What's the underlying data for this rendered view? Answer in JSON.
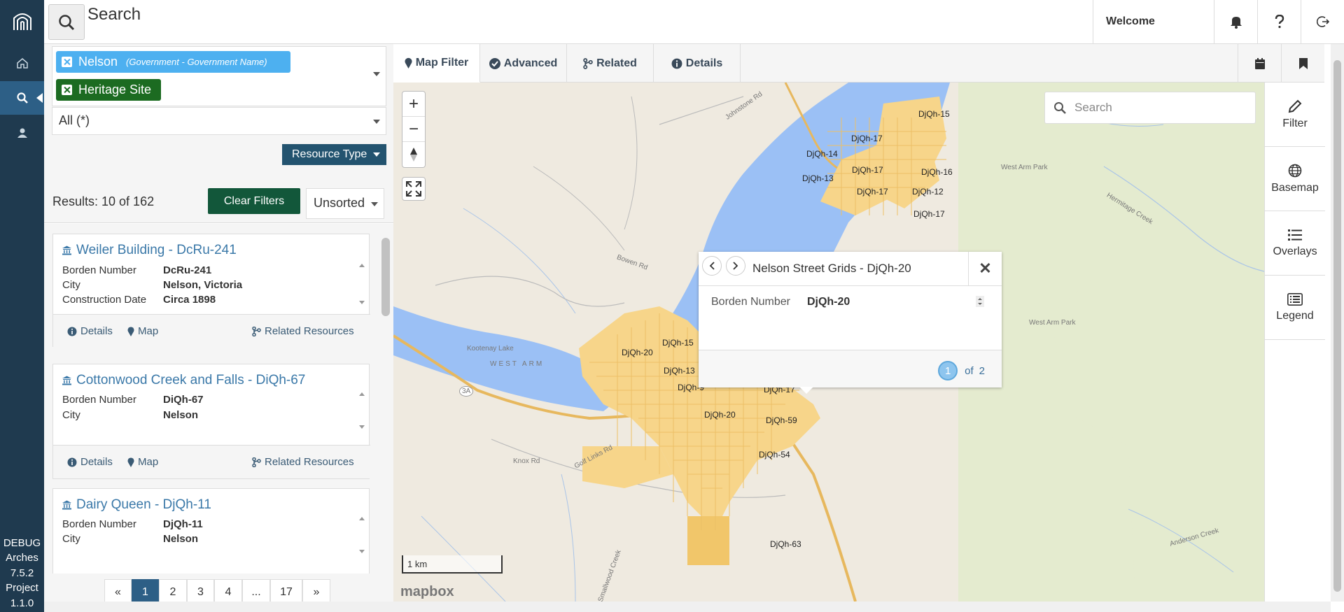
{
  "topbar": {
    "title": "Search",
    "welcome": "Welcome"
  },
  "nav": {
    "version_lines": [
      "DEBUG",
      "Arches",
      "7.5.2",
      "Project",
      "1.1.0"
    ]
  },
  "filters": {
    "tags": [
      {
        "label": "Nelson",
        "sub": "(Government - Government Name)",
        "color": "#4db0f0"
      },
      {
        "label": "Heritage Site",
        "color": "#1c6b21"
      }
    ],
    "all_select": "All (*)",
    "resource_type": "Resource Type"
  },
  "results": {
    "count": "Results: 10 of 162",
    "clear_filters": "Clear Filters",
    "sort": "Unsorted",
    "cards": [
      {
        "title": "Weiler Building - DcRu-241",
        "rows": [
          {
            "label": "Borden Number",
            "value": "DcRu-241"
          },
          {
            "label": "City",
            "value": "Nelson, Victoria"
          },
          {
            "label": "Construction Date",
            "value": "Circa 1898"
          }
        ]
      },
      {
        "title": "Cottonwood Creek and Falls - DiQh-67",
        "rows": [
          {
            "label": "Borden Number",
            "value": "DiQh-67"
          },
          {
            "label": "City",
            "value": "Nelson"
          }
        ]
      },
      {
        "title": "Dairy Queen - DjQh-11",
        "rows": [
          {
            "label": "Borden Number",
            "value": "DjQh-11"
          },
          {
            "label": "City",
            "value": "Nelson"
          }
        ]
      }
    ],
    "actions": {
      "details": "Details",
      "map": "Map",
      "related": "Related Resources"
    }
  },
  "pager": {
    "prev": "«",
    "pages": [
      "1",
      "2",
      "3",
      "4",
      "...",
      "17"
    ],
    "next": "»",
    "current": "1"
  },
  "map_tabs": {
    "map_filter": "Map Filter",
    "advanced": "Advanced",
    "related": "Related",
    "details": "Details"
  },
  "map": {
    "search_placeholder": "Search",
    "scale": "1 km",
    "attribution": "mapbox",
    "labels": [
      "DjQh-15",
      "DjQh-17",
      "DjQh-14",
      "DjQh-17",
      "DjQh-16",
      "DjQh-13",
      "DjQh-17",
      "DjQh-12",
      "DjQh-17",
      "DjQh-20",
      "DjQh-15",
      "DjQh-13",
      "DjQh-9",
      "DjQh-17",
      "DjQh-20",
      "DjQh-59",
      "DjQh-54",
      "DjQh-63"
    ],
    "place_names": [
      "Kootenay Lake",
      "WEST ARM",
      "West Arm Park",
      "Hermitage Creek",
      "West Arm Park",
      "Anderson Creek",
      "Knox Rd",
      "Golf Links Rd",
      "Smallwood Creek",
      "Johnstone Rd",
      "Bowen Rd",
      "3A"
    ]
  },
  "popup": {
    "title": "Nelson Street Grids - DjQh-20",
    "row_label": "Borden Number",
    "row_value": "DjQh-20",
    "page": "1",
    "of": "of",
    "total": "2"
  },
  "right_panel": {
    "filter": "Filter",
    "basemap": "Basemap",
    "overlays": "Overlays",
    "legend": "Legend"
  },
  "colors": {
    "nav": "#1f3a4f",
    "accent": "#2d5f86",
    "water": "#9bc0f5",
    "land": "#efeae0",
    "urban": "#f7d58a"
  }
}
